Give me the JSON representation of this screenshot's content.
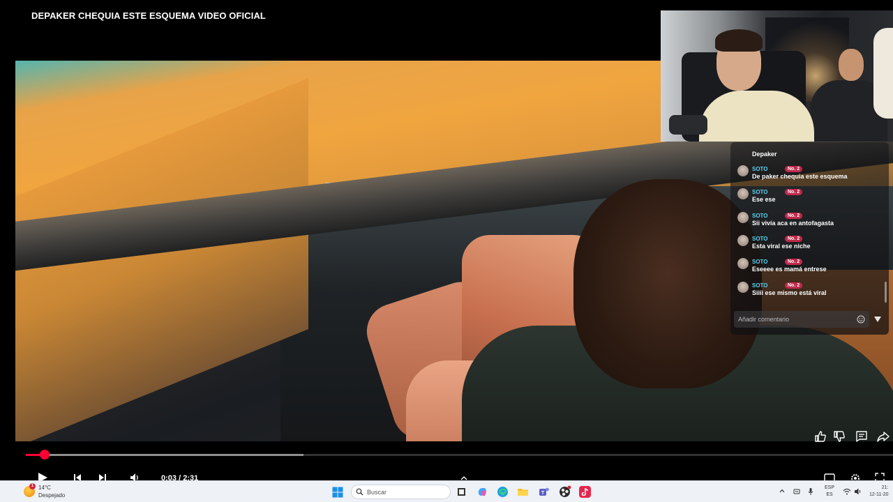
{
  "video": {
    "title": "DEPAKER CHEQUIA ESTE ESQUEMA VIDEO OFICIAL",
    "current_time": "0:03",
    "duration": "2:31",
    "time_separator": " / ",
    "progress_fraction": 0.022,
    "buffered_fraction": 0.32
  },
  "chat": {
    "top_message": "Depaker",
    "messages": [
      {
        "user": "SOTO",
        "badge": "No. 2",
        "text": "De paker chequia este esquema"
      },
      {
        "user": "SOTO",
        "badge": "No. 2",
        "text": "Ese ese"
      },
      {
        "user": "SOTO",
        "badge": "No. 2",
        "text": "Sii vivía aca en antofagasta"
      },
      {
        "user": "SOTO",
        "badge": "No. 2",
        "text": "Esta viral ese niche"
      },
      {
        "user": "SOTO",
        "badge": "No. 2",
        "text": "Eseeee es mamá entrese"
      },
      {
        "user": "SOTO",
        "badge": "No. 2",
        "text": "Siiii ese mismo está viral"
      }
    ],
    "input_placeholder": "Añadir comentario",
    "user_color": "#5ad0f0",
    "badge_color": "#c0294b"
  },
  "side_actions": {
    "icons": [
      "thumbs-up-icon",
      "thumbs-down-icon",
      "comment-icon",
      "share-icon"
    ]
  },
  "player": {
    "accent": "#ff0033",
    "icons": [
      "play-icon",
      "previous-icon",
      "next-icon",
      "volume-icon",
      "subtitles-icon",
      "settings-icon",
      "fullscreen-icon"
    ]
  },
  "taskbar": {
    "weather_temp": "14°C",
    "weather_condition": "Despejado",
    "weather_badge": "1",
    "search_placeholder": "Buscar",
    "language_line1": "ESP",
    "language_line2": "ES",
    "clock_time": "21:",
    "clock_date": "12-11-20",
    "apps": [
      "task-view-icon",
      "copilot-icon",
      "edge-icon",
      "file-explorer-icon",
      "teams-icon",
      "obs-icon",
      "tiktok-icon"
    ]
  }
}
